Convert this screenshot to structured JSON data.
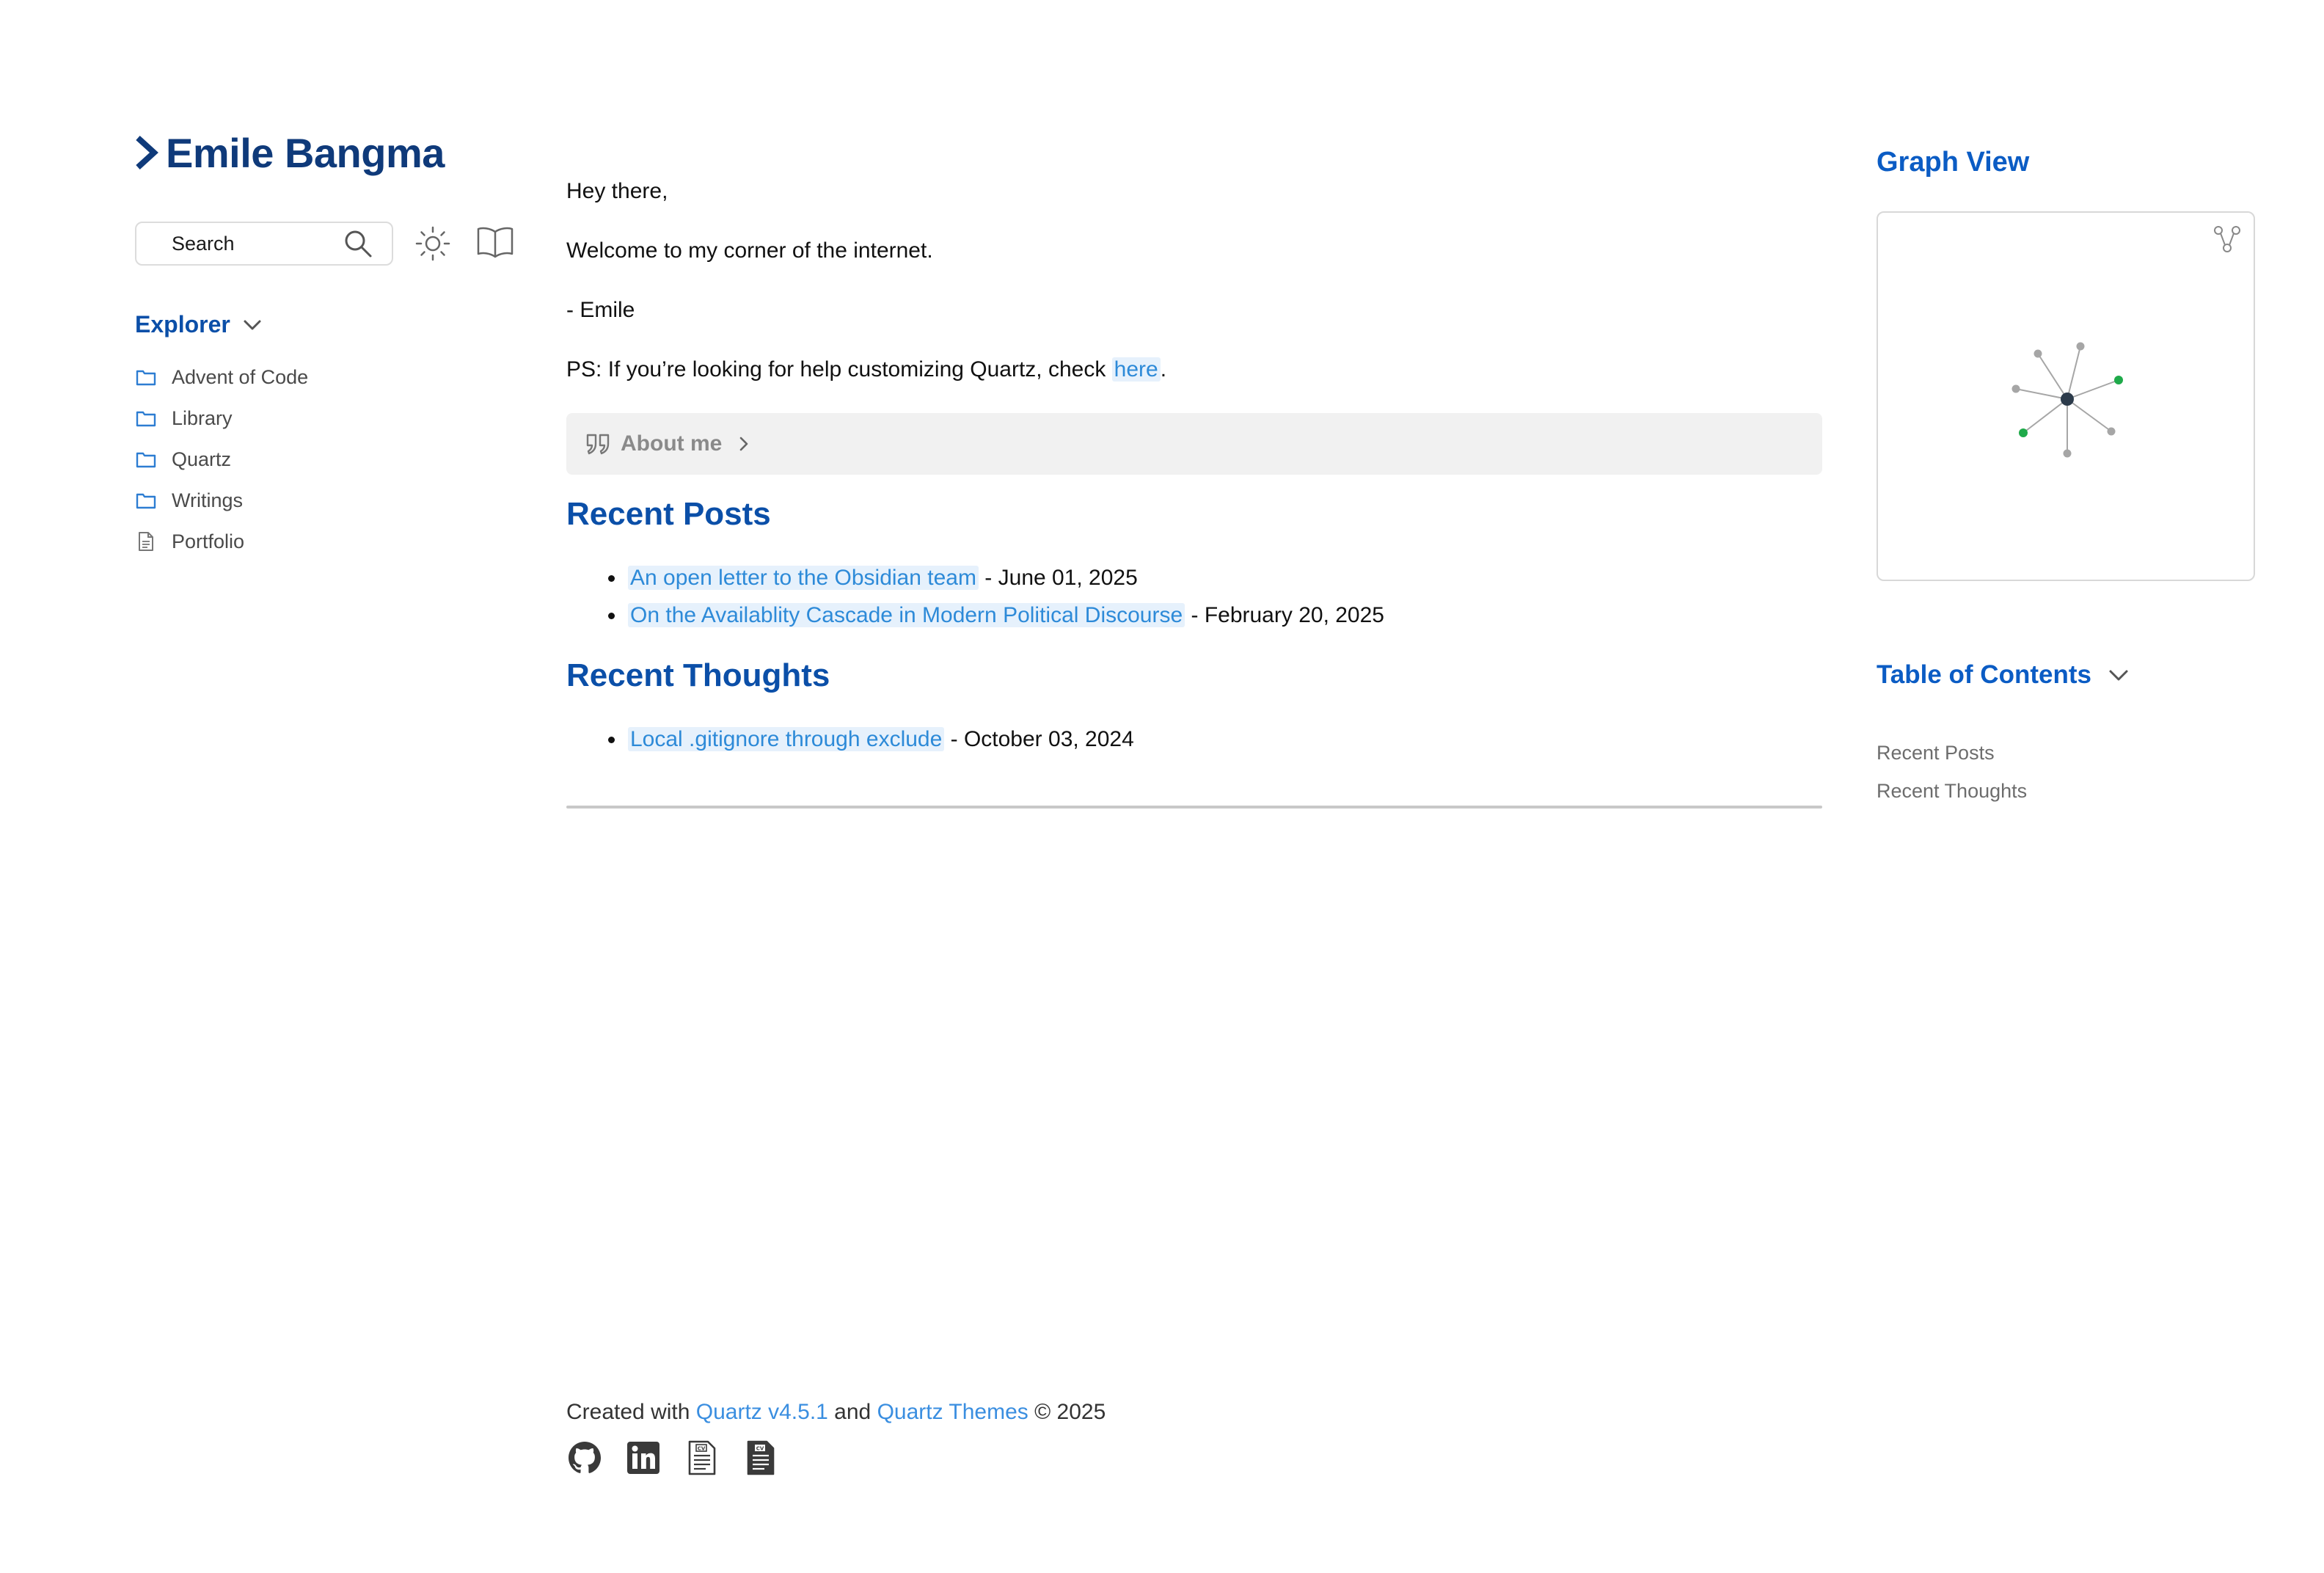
{
  "site": {
    "title": "Emile Bangma"
  },
  "search": {
    "label": "Search"
  },
  "explorer": {
    "title": "Explorer",
    "items": [
      {
        "label": "Advent of Code",
        "type": "folder"
      },
      {
        "label": "Library",
        "type": "folder"
      },
      {
        "label": "Quartz",
        "type": "folder"
      },
      {
        "label": "Writings",
        "type": "folder"
      },
      {
        "label": "Portfolio",
        "type": "file"
      }
    ]
  },
  "content": {
    "greeting": "Hey there,",
    "welcome": "Welcome to my corner of the internet.",
    "signature": "- Emile",
    "ps_text": "PS: If you’re looking for help customizing Quartz, check ",
    "ps_link": "here",
    "ps_end": ".",
    "callout": "About me",
    "recent_posts": {
      "title": "Recent Posts",
      "items": [
        {
          "link": "An open letter to the Obsidian team",
          "date": " - June 01, 2025"
        },
        {
          "link": "On the Availablity Cascade in Modern Political Discourse",
          "date": " - February 20, 2025"
        }
      ]
    },
    "recent_thoughts": {
      "title": "Recent Thoughts",
      "items": [
        {
          "link": "Local .gitignore through exclude",
          "date": " - October 03, 2024"
        }
      ]
    }
  },
  "footer": {
    "prefix": "Created with ",
    "link1": "Quartz v4.5.1",
    "middle": " and ",
    "link2": "Quartz Themes",
    "suffix": " © 2025",
    "icons": [
      "github-icon",
      "linkedin-icon",
      "cv-outline-icon",
      "cv-filled-icon"
    ]
  },
  "graph": {
    "title": "Graph View"
  },
  "toc": {
    "title": "Table of Contents",
    "items": [
      "Recent Posts",
      "Recent Thoughts"
    ]
  },
  "colors": {
    "title": "#0f3a7a",
    "heading": "#0b4fa8",
    "link": "#2d8ad8",
    "link_bg": "#e6f1fc",
    "graph_node_center": "#2b3a4a",
    "graph_node_gray": "#a6a6a6",
    "graph_node_green": "#1faa4a"
  }
}
